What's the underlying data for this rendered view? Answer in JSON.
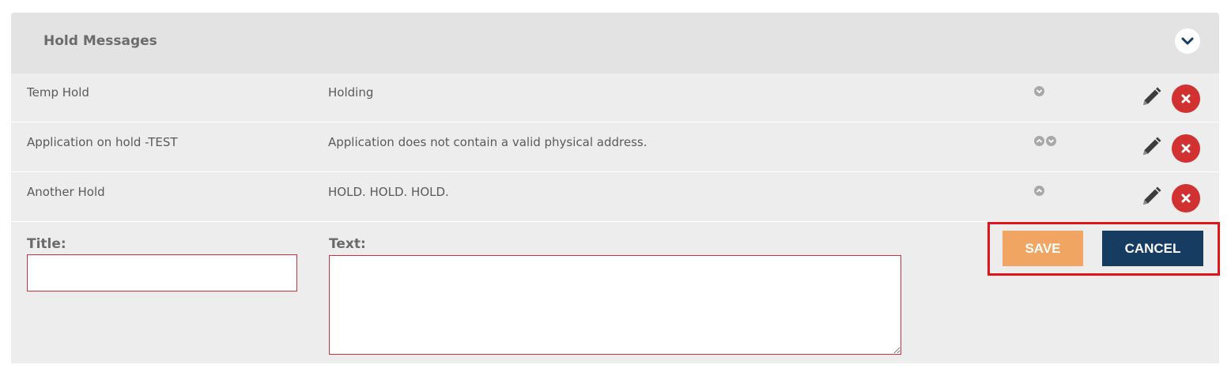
{
  "panel": {
    "title": "Hold Messages"
  },
  "holds": [
    {
      "title": "Temp Hold",
      "text": "Holding",
      "order_icons": [
        "move-down"
      ]
    },
    {
      "title": "Application on hold -TEST",
      "text": "Application does not contain a valid physical address.",
      "order_icons": [
        "move-up",
        "move-down"
      ]
    },
    {
      "title": "Another Hold",
      "text": "HOLD. HOLD. HOLD.",
      "order_icons": [
        "move-up"
      ]
    }
  ],
  "form": {
    "title_label": "Title:",
    "text_label": "Text:",
    "title_value": "",
    "text_value": "",
    "save_label": "SAVE",
    "cancel_label": "CANCEL"
  },
  "colors": {
    "header_bg": "#e3e3e3",
    "row_bg": "#ededed",
    "save": "#f0a562",
    "cancel": "#163c62",
    "delete": "#d13131",
    "invalid_border": "#c9313b",
    "highlight": "#e2141b"
  }
}
